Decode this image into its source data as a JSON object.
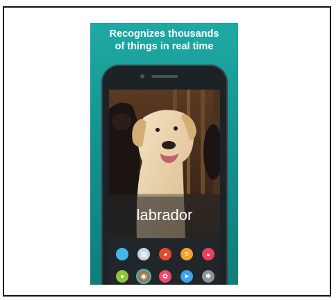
{
  "promo": {
    "headline_line1": "Recognizes thousands",
    "headline_line2": "of things in real time"
  },
  "camera_view": {
    "detected_label": "labrador"
  },
  "toolbar": {
    "icons": [
      {
        "name": "circle-icon",
        "color": "#41b8e8",
        "glyph": ""
      },
      {
        "name": "gift-icon",
        "color": "#c9d3df",
        "glyph": "▦"
      },
      {
        "name": "color-wheel-icon",
        "color": "#e5472f",
        "glyph": "◕"
      },
      {
        "name": "burger-icon",
        "color": "#f1a42a",
        "glyph": "≡"
      },
      {
        "name": "basket-icon",
        "color": "#e8425a",
        "glyph": "◒"
      },
      {
        "name": "fruit-icon",
        "color": "#8cc63f",
        "glyph": "●"
      },
      {
        "name": "dog-icon",
        "color": "#a07a4d",
        "glyph": "◉"
      },
      {
        "name": "flower-icon",
        "color": "#ee4b6a",
        "glyph": "✿"
      },
      {
        "name": "location-arrow-icon",
        "color": "#3ba4e6",
        "glyph": "➤"
      },
      {
        "name": "gear-icon",
        "color": "#8a949c",
        "glyph": "✱"
      }
    ],
    "selected_icon": "dog-icon"
  }
}
